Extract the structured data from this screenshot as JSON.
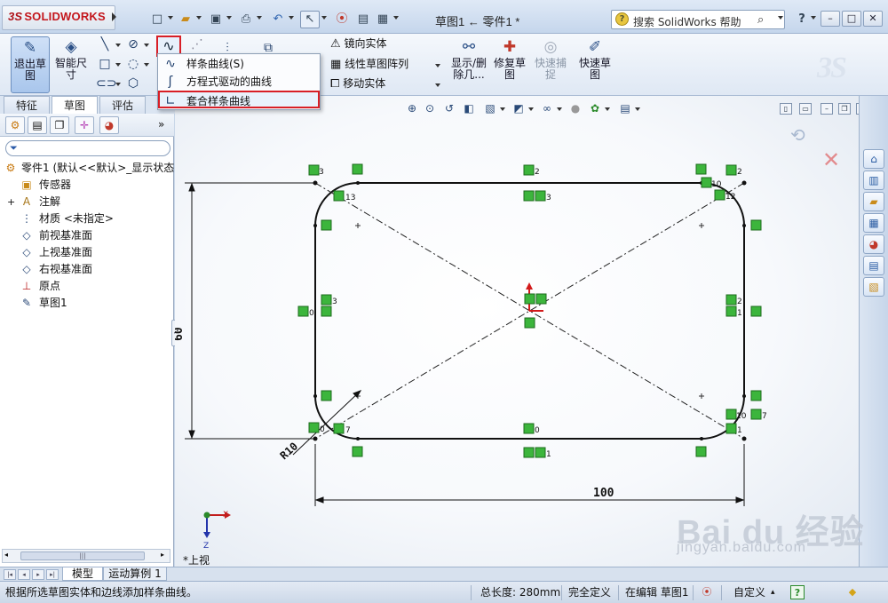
{
  "app": {
    "logo": "SOLIDWORKS",
    "logo_mark": "3S",
    "window_title": "草图1 ← 零件1 *",
    "search_placeholder": "搜索 SolidWorks 帮助",
    "help_glyph": "?"
  },
  "command_manager": {
    "exit_sketch": "退出草图",
    "smart_dimension": "智能尺寸",
    "mirror": "镜向实体",
    "linear_pattern": "线性草图阵列",
    "move": "移动实体",
    "display_delete": "显示/删除几...",
    "repair": "修复草图",
    "quick_snap": "快速捕捉",
    "rapid_sketch": "快速草图",
    "partial_label": "实"
  },
  "spline_menu": {
    "items": [
      {
        "label": "样条曲线(S)"
      },
      {
        "label": "方程式驱动的曲线"
      },
      {
        "label": "套合样条曲线",
        "highlighted": true
      }
    ]
  },
  "tabs": {
    "items": [
      {
        "label": "特征"
      },
      {
        "label": "草图",
        "active": true
      },
      {
        "label": "评估"
      }
    ]
  },
  "feature_tree": {
    "items": [
      {
        "label": "零件1 (默认<<默认>_显示状态",
        "icon": "part-icon"
      },
      {
        "label": "传感器",
        "icon": "sensor-icon"
      },
      {
        "label": "注解",
        "icon": "annotation-icon"
      },
      {
        "label": "材质 <未指定>",
        "icon": "material-icon"
      },
      {
        "label": "前视基准面",
        "icon": "plane-icon"
      },
      {
        "label": "上视基准面",
        "icon": "plane-icon"
      },
      {
        "label": "右视基准面",
        "icon": "plane-icon"
      },
      {
        "label": "原点",
        "icon": "origin-icon"
      },
      {
        "label": "草图1",
        "icon": "sketch-icon"
      }
    ],
    "expand_marks": [
      "+",
      "+"
    ]
  },
  "sketch": {
    "dim_width": "100",
    "dim_height": "60",
    "dim_radius": "R10",
    "relations": [
      {
        "label": "3"
      },
      {
        "label": "2"
      },
      {
        "label": "2"
      },
      {
        "label": "13"
      },
      {
        "label": "3"
      },
      {
        "label": "10"
      },
      {
        "label": "12"
      },
      {
        "label": "0"
      },
      {
        "label": "3"
      },
      {
        "label": "2"
      },
      {
        "label": "1"
      },
      {
        "label": "0"
      },
      {
        "label": "7"
      },
      {
        "label": "0"
      },
      {
        "label": "10"
      },
      {
        "label": "7"
      },
      {
        "label": "1"
      },
      {
        "label": "1"
      }
    ]
  },
  "view": {
    "label": "*上视",
    "axis_x": "X",
    "axis_z": "Z"
  },
  "bottom_tabs": {
    "items": [
      {
        "label": "模型",
        "active": true
      },
      {
        "label": "运动算例 1"
      }
    ]
  },
  "status": {
    "hint": "根据所选草图实体和边线添加样条曲线。",
    "length": "总长度: 280mm",
    "state": "完全定义",
    "editing": "在编辑 草图1",
    "units": "自定义"
  },
  "watermark": {
    "brand": "Bai du 经验",
    "url": "jingyan.baidu.com"
  },
  "colors": {
    "accent": "#d81e26",
    "relation_box": "#3cb53c",
    "sketch_line": "#000000"
  }
}
